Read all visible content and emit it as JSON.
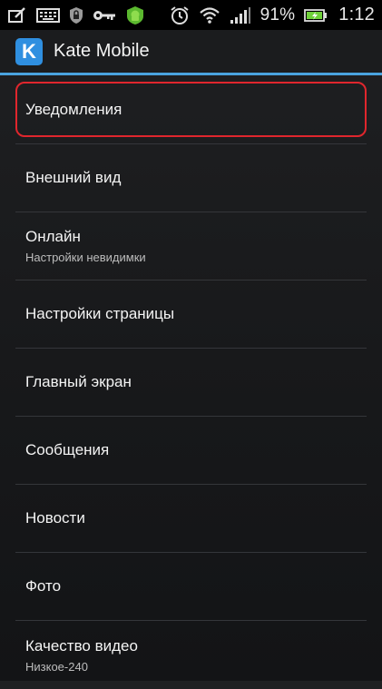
{
  "status_bar": {
    "icons_left": [
      "edit-note-icon",
      "keyboard-icon",
      "shield-icon",
      "key-icon",
      "android-icon"
    ],
    "icons_right": [
      "alarm-icon",
      "wifi-icon",
      "signal-icon",
      "battery-charging-icon"
    ],
    "battery": "91%",
    "clock": "1:12"
  },
  "action_bar": {
    "logo_letter": "K",
    "title": "Kate Mobile",
    "accent_color": "#4aa3df"
  },
  "settings": [
    {
      "title": "Уведомления",
      "subtitle": ""
    },
    {
      "title": "Внешний вид",
      "subtitle": ""
    },
    {
      "title": "Онлайн",
      "subtitle": "Настройки невидимки"
    },
    {
      "title": "Настройки страницы",
      "subtitle": ""
    },
    {
      "title": "Главный экран",
      "subtitle": ""
    },
    {
      "title": "Сообщения",
      "subtitle": ""
    },
    {
      "title": "Новости",
      "subtitle": ""
    },
    {
      "title": "Фото",
      "subtitle": ""
    },
    {
      "title": "Качество видео",
      "subtitle": "Низкое-240"
    }
  ],
  "highlight_color": "#e0262d"
}
